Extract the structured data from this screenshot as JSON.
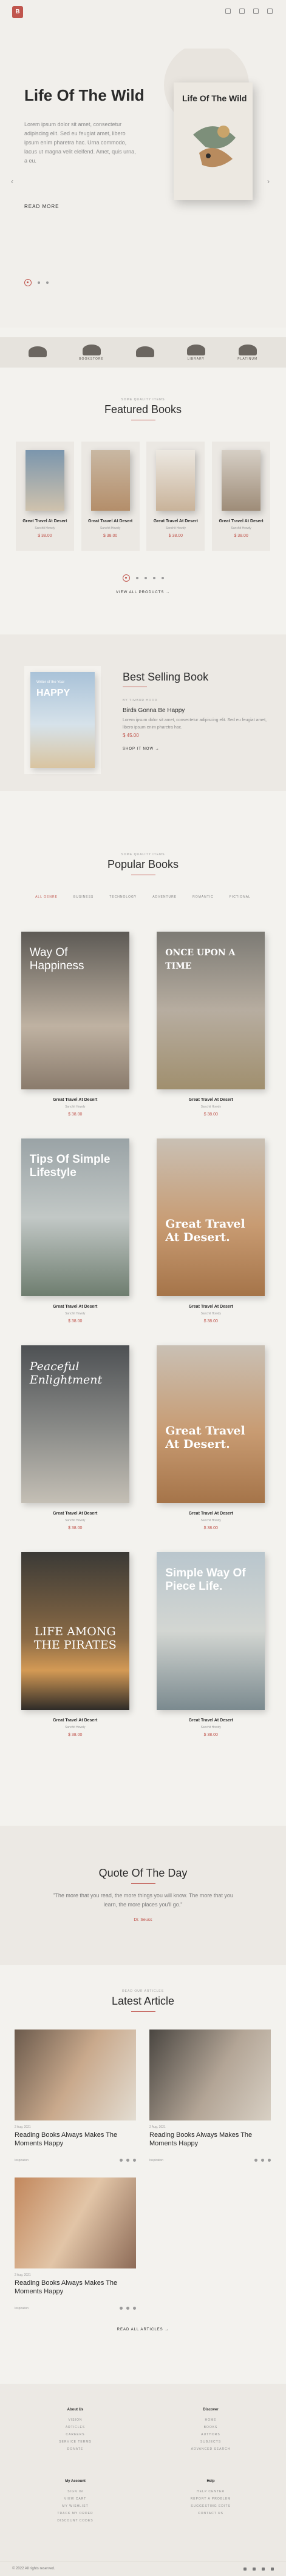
{
  "header": {
    "logo": "B"
  },
  "hero": {
    "title": "Life Of The Wild",
    "description": "Lorem ipsum dolor sit amet, consectetur adipiscing elit. Sed eu feugiat amet, libero ipsum enim pharetra hac. Urna commodo, lacus ut magna velit eleifend. Amet, quis urna, a eu.",
    "read_more": "Read More",
    "book_title": "Life Of The Wild",
    "prev_arrow": "‹",
    "next_arrow": "›"
  },
  "brands": [
    {
      "name": ""
    },
    {
      "name": "BookStore"
    },
    {
      "name": ""
    },
    {
      "name": "Library"
    },
    {
      "name": "Platinum"
    }
  ],
  "featured": {
    "kicker": "Some quality items",
    "title": "Featured Books",
    "items": [
      {
        "name": "Great Travel At Desert",
        "author": "Sanchit Howdy",
        "price": "$ 38.00"
      },
      {
        "name": "Great Travel At Desert",
        "author": "Sanchit Howdy",
        "price": "$ 38.00"
      },
      {
        "name": "Great Travel At Desert",
        "author": "Sanchit Howdy",
        "price": "$ 38.00"
      },
      {
        "name": "Great Travel At Desert",
        "author": "Sanchit Howdy",
        "price": "$ 38.00"
      }
    ],
    "view_all": "View All Products →"
  },
  "best_selling": {
    "cover_top": "Writer of the Year",
    "cover_title": "HAPPY",
    "title": "Best Selling Book",
    "author": "By Timbur Hood",
    "book_name": "Birds Gonna Be Happy",
    "description": "Lorem ipsum dolor sit amet, consectetur adipiscing elit. Sed eu feugiat amet, libero ipsum enim pharetra hac.",
    "price": "$ 45.00",
    "shop": "Shop It Now →"
  },
  "popular": {
    "kicker": "Some quality items",
    "title": "Popular Books",
    "tabs": [
      "All Genre",
      "Business",
      "Technology",
      "Adventure",
      "Romantic",
      "Fictional"
    ],
    "items": [
      {
        "cover_text": "Way Of Happiness",
        "name": "Great Travel At Desert",
        "author": "Sanchit Howdy",
        "price": "$ 38.00"
      },
      {
        "cover_text": "ONCE UPON A TIME",
        "name": "Great Travel At Desert",
        "author": "Sanchit Howdy",
        "price": "$ 38.00"
      },
      {
        "cover_text": "Tips Of Simple Lifestyle",
        "name": "Great Travel At Desert",
        "author": "Sanchit Howdy",
        "price": "$ 38.00"
      },
      {
        "cover_text": "Great Travel At Desert.",
        "name": "Great Travel At Desert",
        "author": "Sanchit Howdy",
        "price": "$ 38.00"
      },
      {
        "cover_text": "Peaceful Enlightment",
        "name": "Great Travel At Desert",
        "author": "Sanchit Howdy",
        "price": "$ 38.00"
      },
      {
        "cover_text": "Great Travel At Desert.",
        "name": "Great Travel At Desert",
        "author": "Sanchit Howdy",
        "price": "$ 38.00"
      },
      {
        "cover_text": "LIFE AMONG THE PIRATES",
        "name": "Great Travel At Desert",
        "author": "Sanchit Howdy",
        "price": "$ 38.00"
      },
      {
        "cover_text": "Simple Way Of Piece Life.",
        "name": "Great Travel At Desert",
        "author": "Sanchit Howdy",
        "price": "$ 38.00"
      }
    ]
  },
  "quote": {
    "title": "Quote Of The Day",
    "text": "\"The more that you read, the more things you will know. The more that you learn, the more places you'll go.\"",
    "author": "Dr. Seuss"
  },
  "articles": {
    "kicker": "Read our articles",
    "title": "Latest Article",
    "items": [
      {
        "date": "2 Aug, 2021",
        "title": "Reading Books Always Makes The Moments Happy",
        "tag": "Inspiration"
      },
      {
        "date": "2 Aug, 2021",
        "title": "Reading Books Always Makes The Moments Happy",
        "tag": "Inspiration"
      },
      {
        "date": "2 Aug, 2021",
        "title": "Reading Books Always Makes The Moments Happy",
        "tag": "Inspiration"
      }
    ],
    "read_all": "Read All Articles →"
  },
  "footer": {
    "col1": {
      "heading": "About Us",
      "items": [
        "Vision",
        "Articles",
        "Careers",
        "Service Terms",
        "Donate"
      ]
    },
    "col2": {
      "heading": "Discover",
      "items": [
        "Home",
        "Books",
        "Authors",
        "Subjects",
        "Advanced Search"
      ]
    },
    "col3": {
      "heading": "My Account",
      "items": [
        "Sign In",
        "View Cart",
        "My Wishlist",
        "Track My Order",
        "Discount Codes"
      ]
    },
    "col4": {
      "heading": "Help",
      "items": [
        "Help Center",
        "Report A Problem",
        "Suggesting Edits",
        "Contact Us"
      ]
    },
    "copyright": "© 2022 All rights reserved."
  }
}
